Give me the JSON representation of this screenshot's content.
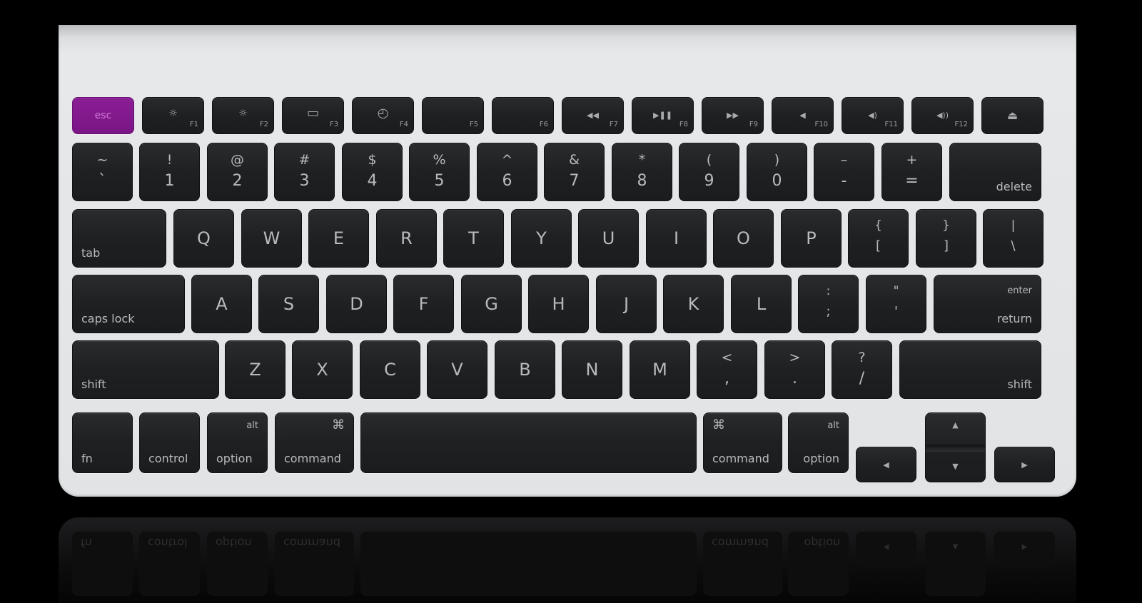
{
  "keyboard": {
    "accent_color": "#7d1788",
    "rows": {
      "function": [
        {
          "id": "esc",
          "label": "esc"
        },
        {
          "id": "f1",
          "icon": "brightness-down-icon",
          "glyph": "☼",
          "fn": "F1"
        },
        {
          "id": "f2",
          "icon": "brightness-up-icon",
          "glyph": "☼",
          "fn": "F2"
        },
        {
          "id": "f3",
          "icon": "expose-icon",
          "glyph": "▭",
          "fn": "F3"
        },
        {
          "id": "f4",
          "icon": "dashboard-icon",
          "glyph": "◴",
          "fn": "F4"
        },
        {
          "id": "f5",
          "fn": "F5"
        },
        {
          "id": "f6",
          "fn": "F6"
        },
        {
          "id": "f7",
          "icon": "rewind-icon",
          "glyph": "◀◀",
          "fn": "F7"
        },
        {
          "id": "f8",
          "icon": "play-pause-icon",
          "glyph": "▶❚❚",
          "fn": "F8"
        },
        {
          "id": "f9",
          "icon": "fast-forward-icon",
          "glyph": "▶▶",
          "fn": "F9"
        },
        {
          "id": "f10",
          "icon": "mute-icon",
          "glyph": "◀",
          "fn": "F10"
        },
        {
          "id": "f11",
          "icon": "volume-down-icon",
          "glyph": "◀)",
          "fn": "F11"
        },
        {
          "id": "f12",
          "icon": "volume-up-icon",
          "glyph": "◀))",
          "fn": "F12"
        },
        {
          "id": "eject",
          "icon": "eject-icon",
          "glyph": "⏏"
        }
      ],
      "number": [
        {
          "top": "~",
          "bottom": "`"
        },
        {
          "top": "!",
          "bottom": "1"
        },
        {
          "top": "@",
          "bottom": "2"
        },
        {
          "top": "#",
          "bottom": "3"
        },
        {
          "top": "$",
          "bottom": "4"
        },
        {
          "top": "%",
          "bottom": "5"
        },
        {
          "top": "^",
          "bottom": "6"
        },
        {
          "top": "&",
          "bottom": "7"
        },
        {
          "top": "*",
          "bottom": "8"
        },
        {
          "top": "(",
          "bottom": "9"
        },
        {
          "top": ")",
          "bottom": "0"
        },
        {
          "top": "–",
          "bottom": "-"
        },
        {
          "top": "+",
          "bottom": "="
        },
        {
          "label": "delete"
        }
      ],
      "qwerty": [
        {
          "label": "tab"
        },
        {
          "letter": "Q"
        },
        {
          "letter": "W"
        },
        {
          "letter": "E"
        },
        {
          "letter": "R"
        },
        {
          "letter": "T"
        },
        {
          "letter": "Y"
        },
        {
          "letter": "U"
        },
        {
          "letter": "I"
        },
        {
          "letter": "O"
        },
        {
          "letter": "P"
        },
        {
          "top": "{",
          "bottom": "["
        },
        {
          "top": "}",
          "bottom": "]"
        },
        {
          "top": "|",
          "bottom": "\\"
        }
      ],
      "home": [
        {
          "label": "caps lock"
        },
        {
          "letter": "A"
        },
        {
          "letter": "S"
        },
        {
          "letter": "D"
        },
        {
          "letter": "F"
        },
        {
          "letter": "G"
        },
        {
          "letter": "H"
        },
        {
          "letter": "J"
        },
        {
          "letter": "K"
        },
        {
          "letter": "L"
        },
        {
          "top": ":",
          "bottom": ";"
        },
        {
          "top": "\"",
          "bottom": "'"
        },
        {
          "top_label": "enter",
          "label": "return"
        }
      ],
      "shift": [
        {
          "label": "shift"
        },
        {
          "letter": "Z"
        },
        {
          "letter": "X"
        },
        {
          "letter": "C"
        },
        {
          "letter": "V"
        },
        {
          "letter": "B"
        },
        {
          "letter": "N"
        },
        {
          "letter": "M"
        },
        {
          "top": "<",
          "bottom": ","
        },
        {
          "top": ">",
          "bottom": "."
        },
        {
          "top": "?",
          "bottom": "/"
        },
        {
          "label": "shift"
        }
      ],
      "bottom": [
        {
          "id": "fn",
          "label": "fn"
        },
        {
          "id": "control",
          "label": "control"
        },
        {
          "id": "option-left",
          "top_label": "alt",
          "label": "option"
        },
        {
          "id": "command-left",
          "symbol": "⌘",
          "label": "command"
        },
        {
          "id": "space",
          "label": ""
        },
        {
          "id": "command-right",
          "symbol": "⌘",
          "label": "command"
        },
        {
          "id": "option-right",
          "top_label": "alt",
          "label": "option"
        },
        {
          "id": "arrow-left",
          "glyph": "◀"
        },
        {
          "id": "arrow-up",
          "glyph": "▲"
        },
        {
          "id": "arrow-down",
          "glyph": "▼"
        },
        {
          "id": "arrow-right",
          "glyph": "▶"
        }
      ]
    }
  }
}
